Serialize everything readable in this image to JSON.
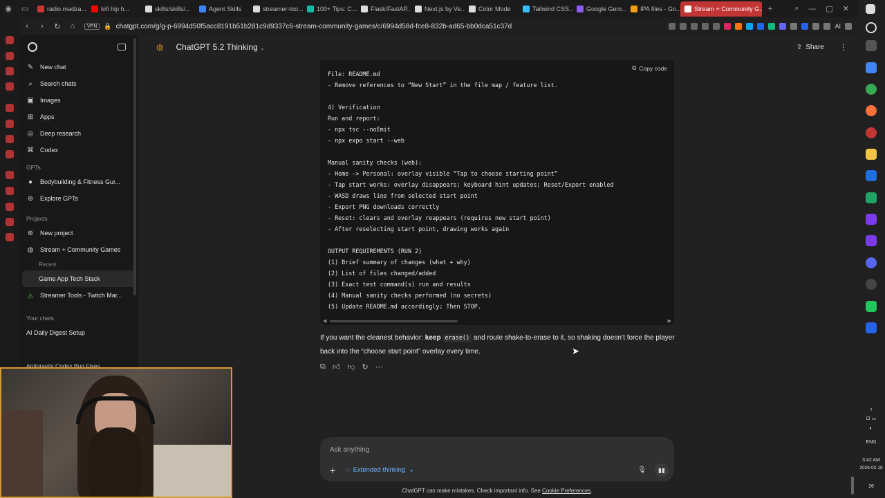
{
  "browser": {
    "tabs": [
      {
        "label": "radio.madza...",
        "color": "#cc3333"
      },
      {
        "label": "lofi hip h...",
        "color": "#ff0000"
      },
      {
        "label": "skills/skills/...",
        "color": "#dddddd"
      },
      {
        "label": "Agent Skills",
        "color": "#3b82f6"
      },
      {
        "label": "streamer-too...",
        "color": "#dddddd"
      },
      {
        "label": "100+ Tips: C...",
        "color": "#14b8a6"
      },
      {
        "label": "Flask/FastAP...",
        "color": "#dddddd"
      },
      {
        "label": "Next.js by Ve...",
        "color": "#dddddd"
      },
      {
        "label": "Color Mode",
        "color": "#dddddd"
      },
      {
        "label": "Tailwind CSS...",
        "color": "#38bdf8"
      },
      {
        "label": "Google Gem...",
        "color": "#8b5cf6"
      },
      {
        "label": "IPA files - Go...",
        "color": "#f59e0b"
      },
      {
        "label": "Stream + Community G...",
        "color": "#ffffff"
      }
    ],
    "url": "chatgpt.com/g/g-p-6994d50f5acc8191b51b281c9d9337c6-stream-community-games/c/6994d58d-fce8-832b-ad65-bb0dca51c37d",
    "vpn": "VPN",
    "ext_label": "AI"
  },
  "sidebar": {
    "items": [
      {
        "icon": "✎",
        "label": "New chat"
      },
      {
        "icon": "⌕",
        "label": "Search chats"
      },
      {
        "icon": "▣",
        "label": "Images"
      },
      {
        "icon": "⊞",
        "label": "Apps"
      },
      {
        "icon": "◎",
        "label": "Deep research"
      },
      {
        "icon": "⌘",
        "label": "Codex"
      }
    ],
    "gpts_header": "GPTs",
    "gpts": [
      {
        "icon": "●",
        "label": "Bodybuilding & Fitness Gur..."
      },
      {
        "icon": "⊛",
        "label": "Explore GPTs"
      }
    ],
    "projects_header": "Projects",
    "projects": [
      {
        "icon": "⊕",
        "label": "New project"
      },
      {
        "icon": "◍",
        "label": "Stream + Community Games"
      }
    ],
    "recent_label": "Recent",
    "recent_item": "Game App Tech Stack",
    "streamer_tools": "Streamer Tools - Twitch Mar...",
    "your_chats_header": "Your chats",
    "chats": [
      "AI Daily Digest Setup",
      "Antigravity Codex Bug Fixes"
    ]
  },
  "header": {
    "model": "ChatGPT 5.2 Thinking",
    "share": "Share"
  },
  "codeblock": {
    "copy_label": "Copy code",
    "lines": [
      "File: README.md",
      "- Remove references to “New Start” in the file map / feature list.",
      "",
      "4) Verification",
      "Run and report:",
      "- npx tsc --noEmit",
      "- npx expo start --web",
      "",
      "Manual sanity checks (web):",
      "- Home -> Personal: overlay visible “Tap to choose starting point”",
      "- Tap start works: overlay disappears; keyboard hint updates; Reset/Export enabled",
      "- WASD draws line from selected start point",
      "- Export PNG downloads correctly",
      "- Reset: clears and overlay reappears (requires new start point)",
      "- After reselecting start point, drawing works again",
      "",
      "OUTPUT REQUIREMENTS (RUN 2)",
      "(1) Brief summary of changes (what + why)",
      "(2) List of files changed/added",
      "(3) Exact test command(s) run and results",
      "(4) Manual sanity checks performed (no secrets)",
      "(5) Update README.md accordingly; Then STOP."
    ]
  },
  "reply": {
    "pre": "If you want the cleanest behavior: ",
    "bold": "keep",
    "code": "erase()",
    "post": " and route shake-to-erase to it, so shaking doesn’t force the player back into the “choose start point” overlay every time."
  },
  "composer": {
    "placeholder": "Ask anything",
    "thinking": "Extended thinking"
  },
  "footer": {
    "text": "ChatGPT can make mistakes. Check important info. See ",
    "link": "Cookie Preferences",
    "end": "."
  },
  "taskbar": {
    "lang": "ENG",
    "time": "3:42 AM",
    "date": "2026-02-18",
    "badge": "26"
  }
}
